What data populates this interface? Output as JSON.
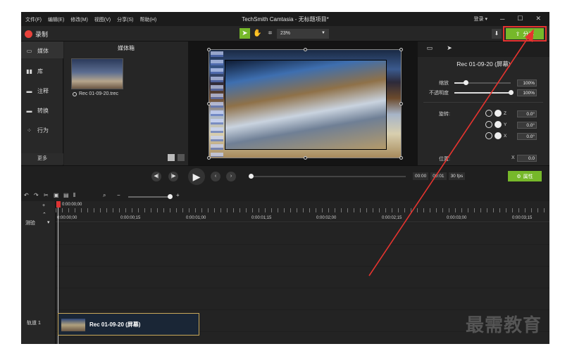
{
  "window": {
    "menu": [
      "文件(F)",
      "编辑(E)",
      "修改(M)",
      "视图(V)",
      "分享(S)",
      "帮助(H)"
    ],
    "title": "TechSmith Camtasia - 无标题项目*",
    "login": "登录 ▾",
    "controls": [
      "─",
      "☐",
      "✕"
    ]
  },
  "toolbar": {
    "record_label": "录制",
    "zoom_value": "23%",
    "share_label": "分享"
  },
  "rail": {
    "items": [
      "媒体",
      "库",
      "注释",
      "转换",
      "行为"
    ],
    "more": "更多"
  },
  "bin": {
    "title": "媒体箱",
    "clip_name": "Rec 01-09-20.trec"
  },
  "props": {
    "title": "Rec 01-09-20 (屏幕)",
    "scale_label": "缩放",
    "scale_value": "100%",
    "scale_level": 0.2,
    "opacity_label": "不透明度",
    "opacity_value": "100%",
    "opacity_level": 1.0,
    "rotation_label": "旋转:",
    "rot_z": "0.0°",
    "rot_y": "0.0°",
    "rot_x": "0.0°",
    "axis_z": "Z",
    "axis_y": "Y",
    "axis_x": "X",
    "position_label": "位置:",
    "pos_x_label": "X",
    "pos_x": "0.0"
  },
  "playback": {
    "current_time": "00:00",
    "frame": "00:01",
    "fps": "30 fps",
    "properties_label": "属性"
  },
  "timeline": {
    "playhead_time": "0:00:00;00",
    "ruler": [
      "0:00:00;00",
      "0:00:00;15",
      "0:00:01;00",
      "0:00:01;15",
      "0:00:02;00",
      "0:00:02;15",
      "0:00:03;00",
      "0:00:03;15"
    ],
    "marker_label": "测验",
    "track_label": "轨道 1",
    "clip_label": "Rec 01-09-20 (屏幕)"
  },
  "watermark": "最需教育",
  "colors": {
    "accent": "#76b82a",
    "highlight": "#e5342f",
    "record": "#e8423b"
  }
}
